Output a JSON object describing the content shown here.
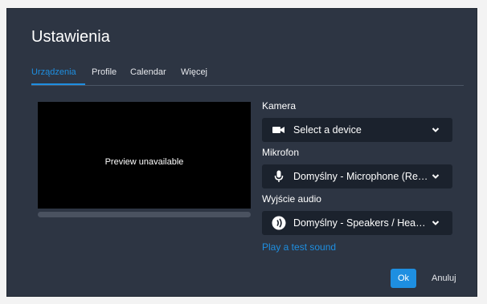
{
  "dialog": {
    "title": "Ustawienia"
  },
  "tabs": [
    {
      "label": "Urządzenia",
      "active": true
    },
    {
      "label": "Profile",
      "active": false
    },
    {
      "label": "Calendar",
      "active": false
    },
    {
      "label": "Więcej",
      "active": false
    }
  ],
  "preview": {
    "text": "Preview unavailable"
  },
  "camera": {
    "label": "Kamera",
    "value": "Select a device",
    "icon": "video-camera-icon"
  },
  "microphone": {
    "label": "Mikrofon",
    "value": "Domyślny - Microphone (Realtek High Definition Audio)",
    "icon": "microphone-icon"
  },
  "audio_output": {
    "label": "Wyjście audio",
    "value": "Domyślny - Speakers / Headphones (Realtek Audio)",
    "icon": "speaker-icon"
  },
  "test_sound_link": "Play a test sound",
  "buttons": {
    "ok": "Ok",
    "cancel": "Anuluj"
  },
  "colors": {
    "accent": "#1e8fe1",
    "dialog_bg": "#2d3543",
    "select_bg": "#1b222d"
  }
}
